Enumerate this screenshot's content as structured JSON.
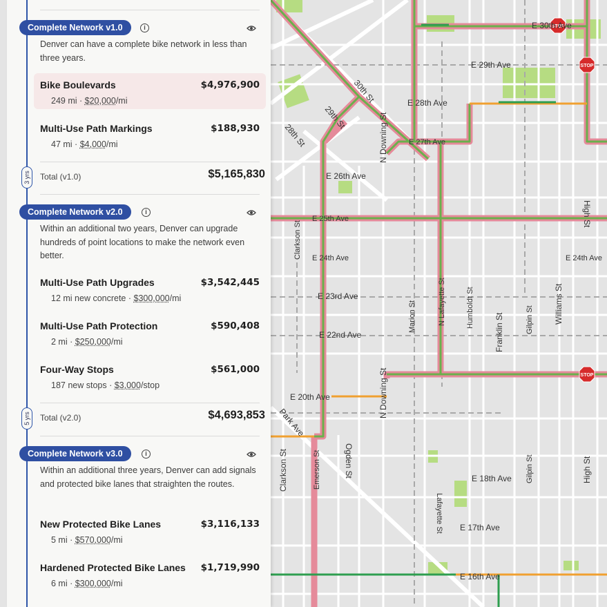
{
  "map": {
    "streets": [
      "E 30th Ave",
      "E 29th Ave",
      "E 28th Ave",
      "E 27th Ave",
      "E 26th Ave",
      "E 25th Ave",
      "E 24th Ave",
      "E 24th Ave",
      "E 23rd Ave",
      "E 22nd Ave",
      "E 20th Ave",
      "E 18th Ave",
      "E 17th Ave",
      "E 16th Ave",
      "30th St",
      "29th St",
      "28th St",
      "N Downing St",
      "N Downing St",
      "Clarkson St",
      "Clarkson St",
      "N Lafayette St",
      "Humboldt St",
      "Franklin St",
      "Gilpin St",
      "Williams St",
      "Marion St",
      "Emerson St",
      "Ogden St",
      "Park Ave",
      "Gilpin St",
      "High St",
      "High St",
      "Lafayette St"
    ],
    "stop_sign_text": "STOP",
    "colors": {
      "route": "#e58a9a",
      "route_core": "#6ab04c",
      "green_lane": "#2e9e4f",
      "orange_lane": "#f0a030",
      "park": "#b6dc82"
    }
  },
  "panel": {
    "sections": [
      {
        "title": "Complete Network v1.0",
        "description": "Denver can have a complete bike network in less than three years.",
        "items": [
          {
            "name": "Bike Boulevards",
            "price": "$4,976,900",
            "qty": "249 mi · ",
            "rate": "$20,000",
            "unit": "/mi"
          },
          {
            "name": "Multi-Use Path Markings",
            "price": "$188,930",
            "qty": "47 mi · ",
            "rate": "$4,000",
            "unit": "/mi"
          }
        ],
        "total_label": "Total (v1.0)",
        "total_value": "$5,165,830",
        "years": "3 yrs"
      },
      {
        "title": "Complete Network v2.0",
        "description": "Within an additional two years, Denver can upgrade hundreds of point locations to make the network even better.",
        "items": [
          {
            "name": "Multi-Use Path Upgrades",
            "price": "$3,542,445",
            "qty": "12 mi new concrete · ",
            "rate": "$300,000",
            "unit": "/mi"
          },
          {
            "name": "Multi-Use Path Protection",
            "price": "$590,408",
            "qty": "2 mi · ",
            "rate": "$250,000",
            "unit": "/mi"
          },
          {
            "name": "Four-Way Stops",
            "price": "$561,000",
            "qty": "187 new stops · ",
            "rate": "$3,000",
            "unit": "/stop"
          }
        ],
        "total_label": "Total (v2.0)",
        "total_value": "$4,693,853",
        "years": "5 yrs"
      },
      {
        "title": "Complete Network v3.0",
        "description": "Within an additional three years, Denver can add signals and protected bike lanes that straighten the routes.",
        "items": [
          {
            "name": "New Protected Bike Lanes",
            "price": "$3,116,133",
            "qty": "5 mi · ",
            "rate": "$570,000",
            "unit": "/mi"
          },
          {
            "name": "Hardened Protected Bike Lanes",
            "price": "$1,719,990",
            "qty": "6 mi · ",
            "rate": "$300,000",
            "unit": "/mi"
          }
        ]
      }
    ],
    "icons": {
      "info": "info-icon",
      "visibility": "eye-icon"
    }
  }
}
